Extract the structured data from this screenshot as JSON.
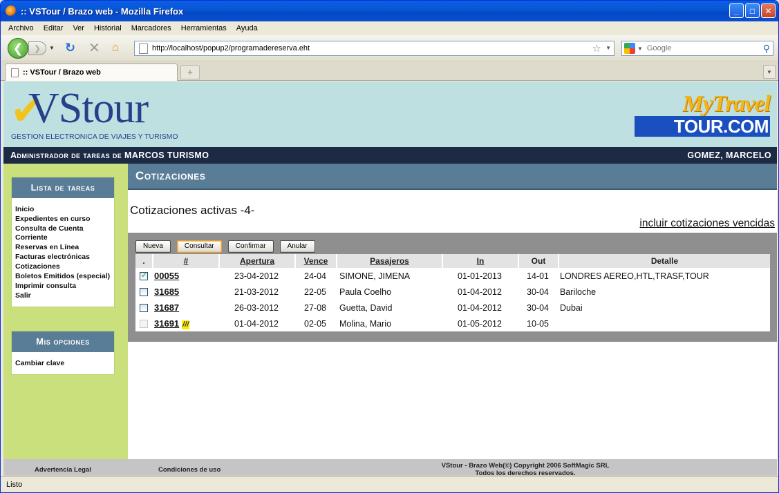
{
  "window": {
    "title": ":: VSTour / Brazo web - Mozilla Firefox"
  },
  "menu": [
    "Archivo",
    "Editar",
    "Ver",
    "Historial",
    "Marcadores",
    "Herramientas",
    "Ayuda"
  ],
  "nav": {
    "url": "http://localhost/popup2/programadereserva.eht",
    "search_placeholder": "Google"
  },
  "tab": {
    "title": ":: VSTour / Brazo web"
  },
  "header": {
    "logo_text": "VStour",
    "logo_subtitle": "GESTION ELECTRONICA DE VIAJES Y TURISMO",
    "mytravel_top": "MyTravel",
    "mytravel_bottom": "TOUR.COM"
  },
  "admin_bar": {
    "left": "Administrador de tareas de MARCOS TURISMO",
    "user": "GOMEZ, MARCELO"
  },
  "sidebar": {
    "tasks_title": "Lista de tareas",
    "tasks": [
      "Inicio",
      "Expedientes en curso",
      "Consulta de Cuenta Corriente",
      "Reservas en Línea",
      "Facturas electrónicas",
      "Cotizaciones",
      "Boletos Emitidos (especial)",
      "Imprimir consulta",
      "Salir"
    ],
    "options_title": "Mis opciones",
    "options": [
      "Cambiar clave"
    ]
  },
  "main": {
    "section_title": "Cotizaciones",
    "count_title": "Cotizaciones activas -4-",
    "include_link": "incluir cotizaciones vencidas",
    "buttons": {
      "nueva": "Nueva",
      "consultar": "Consultar",
      "confirmar": "Confirmar",
      "anular": "Anular"
    },
    "columns": [
      ".",
      "#",
      "Apertura",
      "Vence",
      "Pasajeros",
      "In",
      "Out",
      "Detalle"
    ],
    "rows": [
      {
        "checked": true,
        "disabled": false,
        "num": "00055",
        "flag": "",
        "apertura": "23-04-2012",
        "vence": "24-04",
        "pasajeros": "SIMONE, JIMENA",
        "in": "01-01-2013",
        "out": "14-01",
        "detalle": "LONDRES AEREO,HTL,TRASF,TOUR"
      },
      {
        "checked": false,
        "disabled": false,
        "num": "31685",
        "flag": "",
        "apertura": "21-03-2012",
        "vence": "22-05",
        "pasajeros": "Paula Coelho",
        "in": "01-04-2012",
        "out": "30-04",
        "detalle": "Bariloche"
      },
      {
        "checked": false,
        "disabled": false,
        "num": "31687",
        "flag": "",
        "apertura": "26-03-2012",
        "vence": "27-08",
        "pasajeros": "Guetta, David",
        "in": "01-04-2012",
        "out": "30-04",
        "detalle": "Dubai"
      },
      {
        "checked": false,
        "disabled": true,
        "num": "31691",
        "flag": "///",
        "apertura": "01-04-2012",
        "vence": "02-05",
        "pasajeros": "Molina, Mario",
        "in": "01-05-2012",
        "out": "10-05",
        "detalle": ""
      }
    ]
  },
  "footer": {
    "legal": "Advertencia Legal",
    "terms": "Condiciones de uso",
    "copyright_line1": "VStour - Brazo Web(©) Copyright 2006 SoftMagic SRL",
    "copyright_line2": "Todos los derechos reservados."
  },
  "status": "Listo"
}
